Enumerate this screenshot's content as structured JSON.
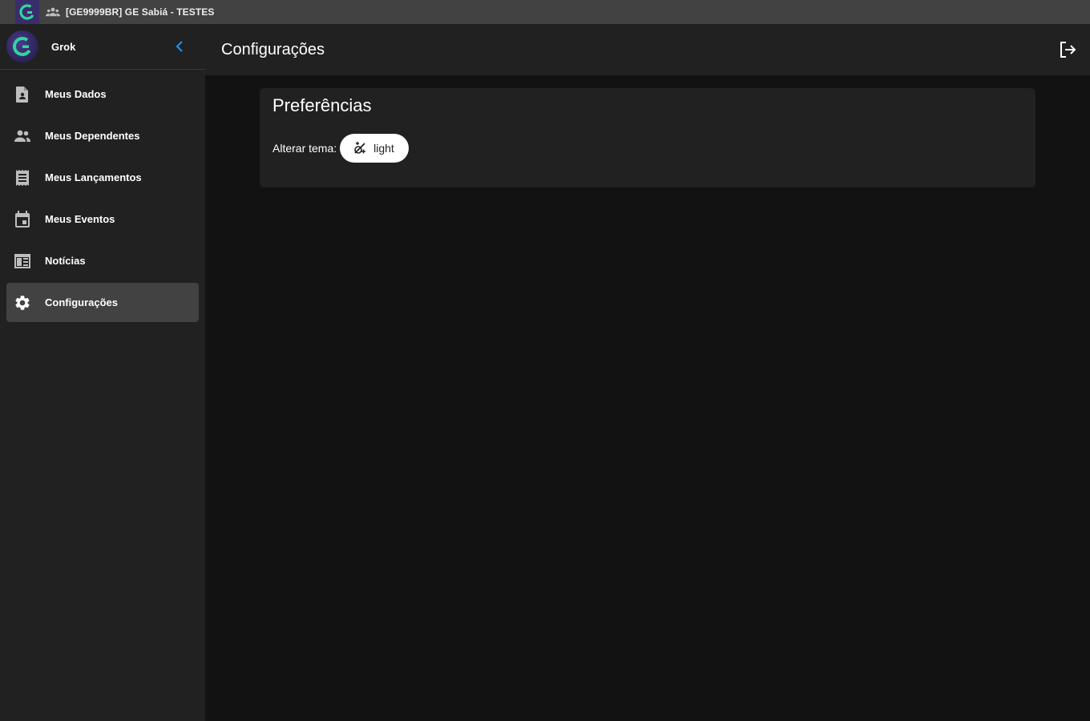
{
  "topbar": {
    "logo_icon": "app-logo-icon",
    "group_icon": "group-icon",
    "title": "[GE9999BR] GE Sabiá - TESTES"
  },
  "sidebar": {
    "user_name": "Grok",
    "collapse_icon": "chevron-left-icon",
    "items": [
      {
        "label": "Meus Dados",
        "icon": "account-file-icon"
      },
      {
        "label": "Meus Dependentes",
        "icon": "people-icon"
      },
      {
        "label": "Meus Lançamentos",
        "icon": "receipt-list-icon"
      },
      {
        "label": "Meus Eventos",
        "icon": "calendar-event-icon"
      },
      {
        "label": "Notícias",
        "icon": "newspaper-icon"
      },
      {
        "label": "Configurações",
        "icon": "gear-icon",
        "active": true
      }
    ]
  },
  "header": {
    "title": "Configurações",
    "logout_icon": "logout-icon"
  },
  "preferences": {
    "title": "Preferências",
    "theme_label": "Alterar tema:",
    "theme_value": "light",
    "theme_icon": "theme-toggle-icon"
  },
  "colors": {
    "topbar": "#424242",
    "sidebar": "#212121",
    "background": "#121212",
    "active_item": "#424242",
    "accent": "#2196f3",
    "logo_green": "#2fd6a0"
  }
}
